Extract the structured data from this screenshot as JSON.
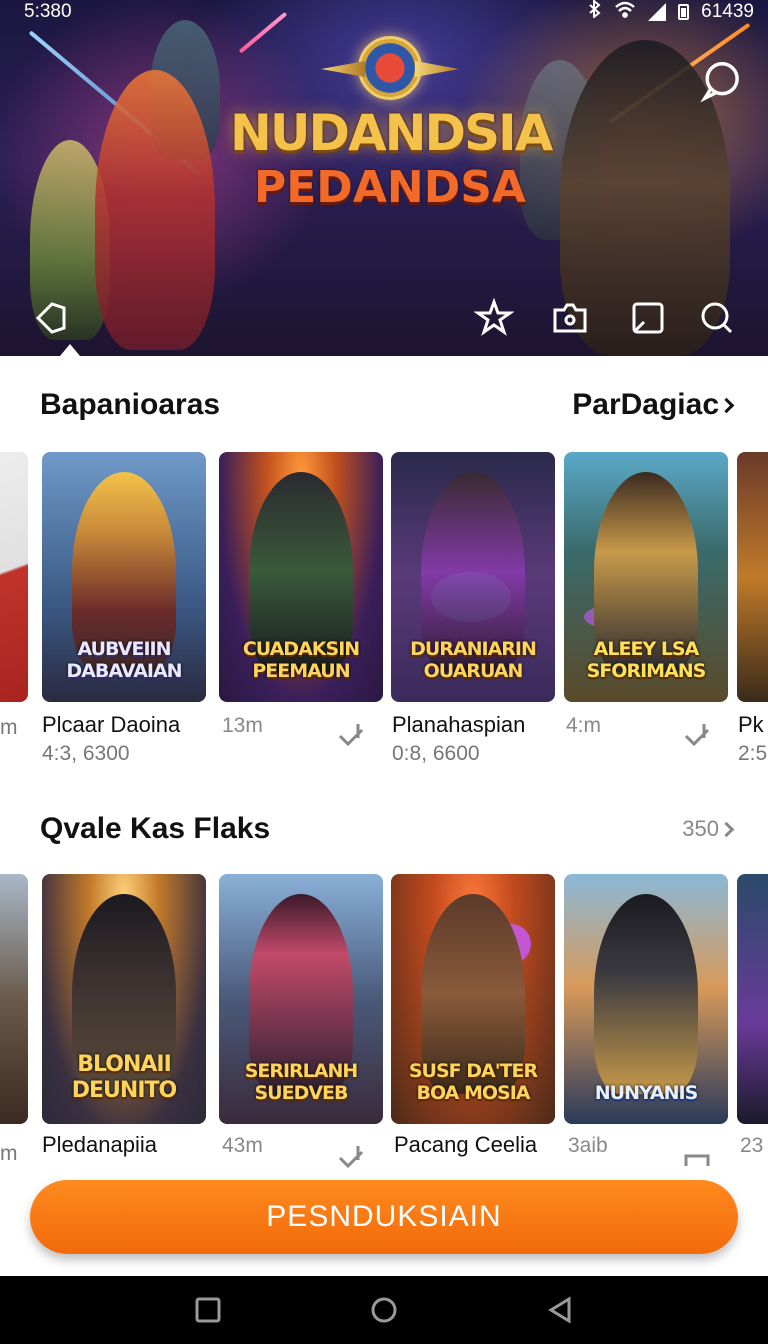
{
  "status_bar": {
    "time": "5:380",
    "right_text": "61439"
  },
  "hero": {
    "logo_title": "NUDANDSIA",
    "logo_subtitle": "PEDANDSA"
  },
  "section1": {
    "title": "Bapanioaras",
    "link": "ParDagiac",
    "cards": [
      {
        "art_title": "",
        "name": "",
        "sub": "m",
        "colors": [
          "#e8e8e8",
          "#c0332a"
        ]
      },
      {
        "art_title": "AUBVEIIN DABAVAIAN",
        "name": "Plcaar Daoina",
        "sub": "4:3, 6300",
        "colors": [
          "#4a6fa0",
          "#c8a048"
        ]
      },
      {
        "art_title": "CUADAKSIN PEEMAUN",
        "name": "",
        "time": "13m",
        "colors": [
          "#3a1f5a",
          "#c2501e"
        ]
      },
      {
        "art_title": "DURANIARIN OUARUAN",
        "name": "Planahaspian",
        "sub": "0:8, 6600",
        "colors": [
          "#2a2a4a",
          "#8a3ab0"
        ]
      },
      {
        "art_title": "ALEEY LSA SFORIMANS",
        "name": "",
        "time": "4:m",
        "colors": [
          "#3a7a9a",
          "#6a5a2a"
        ]
      },
      {
        "art_title": "",
        "name": "Pk",
        "sub": "2:5",
        "colors": [
          "#5a3a2a",
          "#c07a2a"
        ]
      }
    ]
  },
  "section2": {
    "title": "Qvale Kas Flaks",
    "link": "350",
    "cards": [
      {
        "art_title": "",
        "name": "",
        "sub": "m",
        "colors": [
          "#8aa0b8",
          "#8a6a3a"
        ]
      },
      {
        "art_title": "BLONAII DEUNITO",
        "name": "Pledanapiia",
        "colors": [
          "#c27a2a",
          "#2a2a3a"
        ]
      },
      {
        "art_title": "SERIRLANH SUEDVEB",
        "name": "",
        "time": "43m",
        "colors": [
          "#6a8ab8",
          "#4a2a4a"
        ]
      },
      {
        "art_title": "SUSF DA'TER BOA MOSIA",
        "name": "Pacang Ceelia",
        "colors": [
          "#c24a1e",
          "#4a2a1a"
        ]
      },
      {
        "art_title": "NUNYANIS",
        "name": "",
        "time": "3aib",
        "colors": [
          "#d89a5a",
          "#2a3a5a"
        ]
      },
      {
        "art_title": "",
        "name": "",
        "time": "23",
        "colors": [
          "#2a4a6a",
          "#6a3a9a"
        ]
      }
    ]
  },
  "cta": {
    "label": "PESNDUKSIAIN",
    "color": "#f47a14"
  }
}
